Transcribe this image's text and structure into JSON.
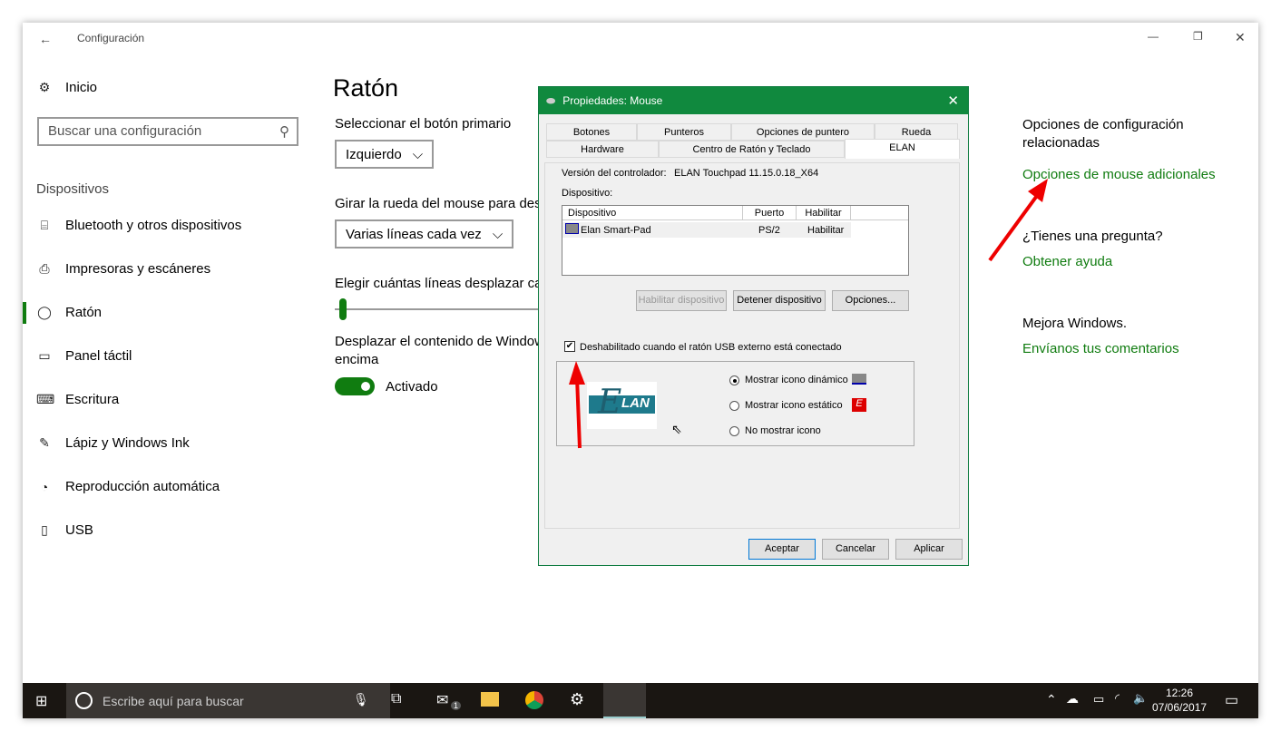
{
  "window": {
    "title": "Configuración",
    "back_icon": "arrow-left",
    "min": "—",
    "max": "❐",
    "close": "✕"
  },
  "sidebar": {
    "home": "Inicio",
    "search_placeholder": "Buscar una configuración",
    "section": "Dispositivos",
    "items": [
      {
        "label": "Bluetooth y otros dispositivos",
        "icon": "⌸"
      },
      {
        "label": "Impresoras y escáneres",
        "icon": "⎙"
      },
      {
        "label": "Ratón",
        "icon": "◯"
      },
      {
        "label": "Panel táctil",
        "icon": "▭"
      },
      {
        "label": "Escritura",
        "icon": "⌨"
      },
      {
        "label": "Lápiz y Windows Ink",
        "icon": "✎"
      },
      {
        "label": "Reproducción automática",
        "icon": "◔"
      },
      {
        "label": "USB",
        "icon": "▯"
      }
    ]
  },
  "main": {
    "title": "Ratón",
    "primary_label": "Seleccionar el botón primario",
    "primary_value": "Izquierdo",
    "wheel_label": "Girar la rueda del mouse para desplazarse",
    "wheel_value": "Varias líneas cada vez",
    "lines_label": "Elegir cuántas líneas desplazar cada vez",
    "scroll_label": "Desplazar el contenido de Windows inactivas al pasar el mouse por encima",
    "scroll_label2": "encima",
    "toggle": "Activado",
    "toggle_on": true
  },
  "related": {
    "heading": "Opciones de configuración relacionadas",
    "link": "Opciones de mouse adicionales",
    "question": "¿Tienes una pregunta?",
    "help": "Obtener ayuda",
    "improve": "Mejora Windows.",
    "feedback": "Envíanos tus comentarios"
  },
  "dialog": {
    "title": "Propiedades: Mouse",
    "tabs_row1": [
      "Botones",
      "Punteros",
      "Opciones de puntero",
      "Rueda"
    ],
    "tabs_row2": [
      "Hardware",
      "Centro de Ratón y Teclado",
      "ELAN"
    ],
    "version_label": "Versión del controlador:",
    "version_value": "ELAN Touchpad 11.15.0.18_X64",
    "device_label": "Dispositivo:",
    "columns": [
      "Dispositivo",
      "Puerto",
      "Habilitar"
    ],
    "rows": [
      {
        "device": "Elan Smart-Pad",
        "port": "PS/2",
        "enable": "Habilitar"
      }
    ],
    "btn_enable": "Habilitar dispositivo",
    "btn_stop": "Detener dispositivo",
    "btn_options": "Opciones...",
    "checkbox": "Deshabilitado cuando el ratón USB externo está conectado",
    "checkbox_checked": true,
    "logo_text": "LAN",
    "radios": [
      "Mostrar icono dinámico",
      "Mostrar icono estático",
      "No mostrar icono"
    ],
    "radio_selected": 0,
    "ok": "Aceptar",
    "cancel": "Cancelar",
    "apply": "Aplicar"
  },
  "taskbar": {
    "search": "Escribe aquí para buscar",
    "time": "12:26",
    "date": "07/06/2017",
    "mail_badge": "1"
  },
  "colors": {
    "accent": "#107c10",
    "dialog_title": "#10893e"
  }
}
